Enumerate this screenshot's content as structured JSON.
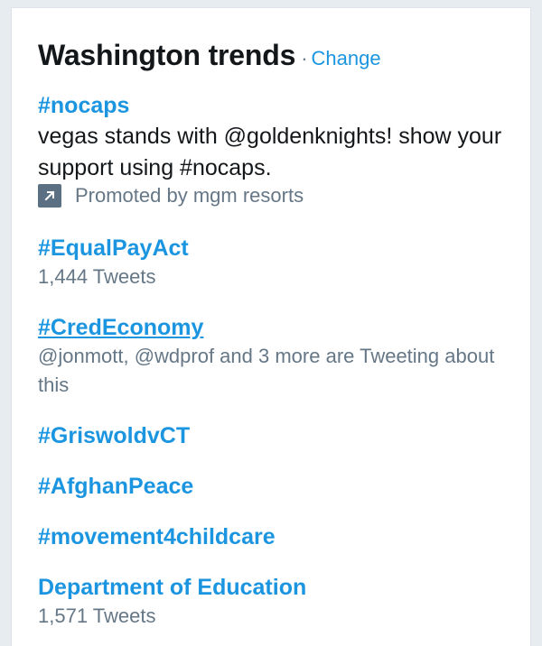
{
  "header": {
    "title": "Washington trends",
    "separator": "·",
    "change_label": "Change"
  },
  "trends": [
    {
      "name": "#nocaps",
      "description": "vegas stands with @goldenknights! show your support using #nocaps.",
      "promoted_text": "Promoted by mgm resorts",
      "promoted_icon": "promoted-arrow-icon"
    },
    {
      "name": "#EqualPayAct",
      "meta": "1,444 Tweets"
    },
    {
      "name": "#CredEconomy",
      "meta": "@jonmott, @wdprof and 3 more are Tweeting about this"
    },
    {
      "name": "#GriswoldvCT"
    },
    {
      "name": "#AfghanPeace"
    },
    {
      "name": "#movement4childcare"
    },
    {
      "name": "Department of Education",
      "meta": "1,571 Tweets"
    }
  ],
  "colors": {
    "link": "#1b95e0",
    "text": "#14171a",
    "secondary": "#657786",
    "background": "#e6ecf0"
  }
}
